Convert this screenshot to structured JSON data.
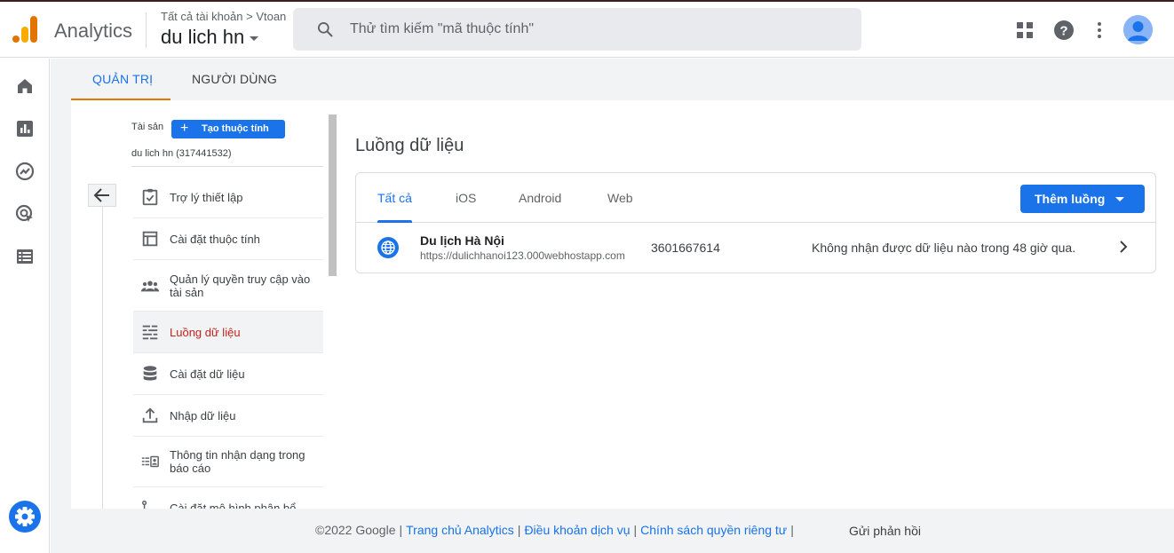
{
  "header": {
    "app_name": "Analytics",
    "breadcrumb": "Tất cả tài khoản > Vtoan",
    "property": "du lich hn",
    "search_placeholder": "Thử tìm kiếm \"mã thuộc tính\"",
    "icons": [
      "apps-grid-icon",
      "help-icon",
      "more-vert-icon",
      "account-avatar"
    ]
  },
  "rail": {
    "items": [
      "home-icon",
      "reports-icon",
      "explore-icon",
      "advertising-icon",
      "configure-icon"
    ],
    "settings": "settings-icon"
  },
  "admin_tabs": {
    "admin": "QUẢN TRỊ",
    "users": "NGƯỜI DÙNG"
  },
  "property_column": {
    "label": "Tài sản",
    "create_button": "Tạo thuộc tính",
    "property_name": "du lich hn (317441532)"
  },
  "menu": {
    "items": [
      {
        "label": "Trợ lý thiết lập"
      },
      {
        "label": "Cài đặt thuộc tính"
      },
      {
        "label": "Quản lý quyền truy cập vào tài sản"
      },
      {
        "label": "Luồng dữ liệu"
      },
      {
        "label": "Cài đặt dữ liệu"
      },
      {
        "label": "Nhập dữ liệu"
      },
      {
        "label": "Thông tin nhận dạng trong báo cáo"
      },
      {
        "label": "Cài đặt mô hình phân bổ"
      }
    ],
    "active_index": 3
  },
  "streams": {
    "title": "Luồng dữ liệu",
    "tabs": [
      "Tất cả",
      "iOS",
      "Android",
      "Web"
    ],
    "active_tab": "Tất cả",
    "add_button": "Thêm luồng",
    "rows": [
      {
        "name": "Du lịch Hà Nội",
        "url": "https://dulichhanoi123.000webhostapp.com",
        "id": "3601667614",
        "status": "Không nhận được dữ liệu nào trong 48 giờ qua."
      }
    ]
  },
  "footer": {
    "copyright": "©2022 Google",
    "links": [
      "Trang chủ Analytics",
      "Điều khoản dịch vụ",
      "Chính sách quyền riêng tư"
    ],
    "feedback": "Gửi phản hồi"
  },
  "colors": {
    "accent_blue": "#1a73e8",
    "tab_underline_orange": "#e37400",
    "active_item_red": "#c5221f"
  }
}
